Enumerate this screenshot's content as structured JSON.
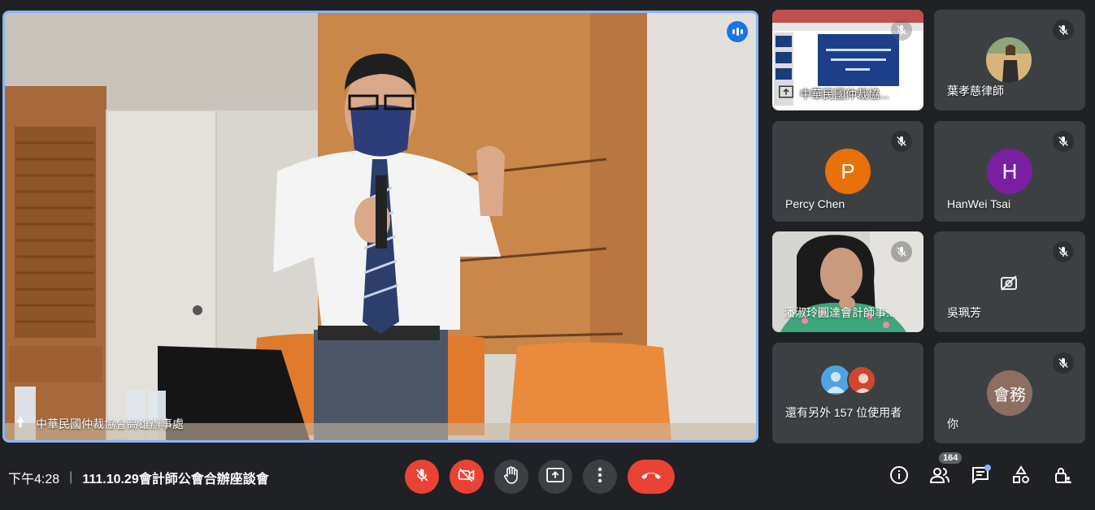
{
  "main_speaker": {
    "name": "中華民國仲裁協會高雄辦事處"
  },
  "participants": [
    {
      "id": "presentation",
      "name": "中華民國仲裁協...",
      "type": "screen"
    },
    {
      "id": "ye",
      "name": "葉孝慈律師",
      "type": "photo"
    },
    {
      "id": "percy",
      "name": "Percy Chen",
      "type": "initial",
      "initial": "P",
      "color": "#e8710a"
    },
    {
      "id": "hanwei",
      "name": "HanWei Tsai",
      "type": "initial",
      "initial": "H",
      "color": "#7b1fa2"
    },
    {
      "id": "pan",
      "name": "潘淑玲圓達會計師事...",
      "type": "video"
    },
    {
      "id": "wu",
      "name": "吳珮芳",
      "type": "camera-off"
    },
    {
      "id": "others",
      "name": "還有另外 157 位使用者",
      "type": "group"
    },
    {
      "id": "you",
      "name": "你",
      "type": "initial",
      "initial": "會務",
      "color": "#8d6e63"
    }
  ],
  "meeting": {
    "time": "下午4:28",
    "separator": "|",
    "title": "111.10.29會計師公會合辦座談會"
  },
  "people_count": "164",
  "colors": {
    "background": "#202124",
    "tile": "#3c4043",
    "danger": "#ea4335",
    "active_border": "#8ab4f8"
  }
}
